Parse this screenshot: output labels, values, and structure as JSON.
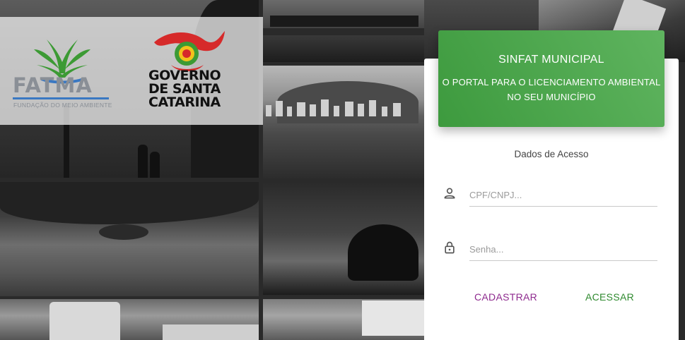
{
  "logos": {
    "fatma": {
      "name": "FATMA",
      "subtitle": "FUNDAÇÃO DO MEIO AMBIENTE"
    },
    "governo": {
      "line1": "GOVERNO",
      "line2": "DE SANTA",
      "line3": "CATARINA"
    }
  },
  "login": {
    "header_title": "SINFAT MUNICIPAL",
    "header_subtitle_line1": "O PORTAL PARA O LICENCIAMENTO AMBIENTAL",
    "header_subtitle_line2": "NO SEU MUNICÍPIO",
    "section_title": "Dados de Acesso",
    "cpf_placeholder": "CPF/CNPJ...",
    "cpf_value": "",
    "password_placeholder": "Senha...",
    "password_value": "",
    "register_label": "CADASTRAR",
    "login_label": "ACESSAR"
  },
  "colors": {
    "header_green": "#4caf50",
    "register_purple": "#8e2a8e",
    "login_green": "#2f8a2f"
  },
  "icons": [
    "user-icon",
    "lock-icon"
  ]
}
